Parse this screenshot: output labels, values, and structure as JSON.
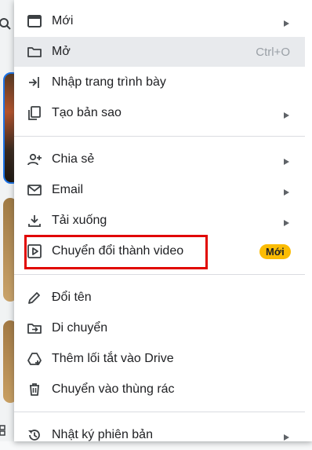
{
  "colors": {
    "accent_badge": "#fbbc04",
    "highlight_row": "#e8eaed",
    "annotation_box": "#e10600",
    "icon": "#3c4043"
  },
  "menu": {
    "items": [
      {
        "label": "Mới",
        "icon": "new-icon",
        "submenu": true
      },
      {
        "label": "Mở",
        "icon": "folder-icon",
        "shortcut": "Ctrl+O",
        "highlighted": true
      },
      {
        "label": "Nhập trang trình bày",
        "icon": "import-icon"
      },
      {
        "label": "Tạo bản sao",
        "icon": "copy-icon",
        "submenu": true
      },
      {
        "label": "Chia sẻ",
        "icon": "share-icon",
        "submenu": true
      },
      {
        "label": "Email",
        "icon": "email-icon",
        "submenu": true
      },
      {
        "label": "Tải xuống",
        "icon": "download-icon",
        "submenu": true
      },
      {
        "label": "Chuyển đổi thành video",
        "icon": "video-icon",
        "badge": "Mới"
      },
      {
        "label": "Đổi tên",
        "icon": "pencil-icon"
      },
      {
        "label": "Di chuyển",
        "icon": "move-icon"
      },
      {
        "label": "Thêm lối tắt vào Drive",
        "icon": "drive-shortcut-icon"
      },
      {
        "label": "Chuyển vào thùng rác",
        "icon": "trash-icon"
      },
      {
        "label": "Nhật ký phiên bản",
        "icon": "history-icon",
        "submenu": true
      }
    ]
  }
}
